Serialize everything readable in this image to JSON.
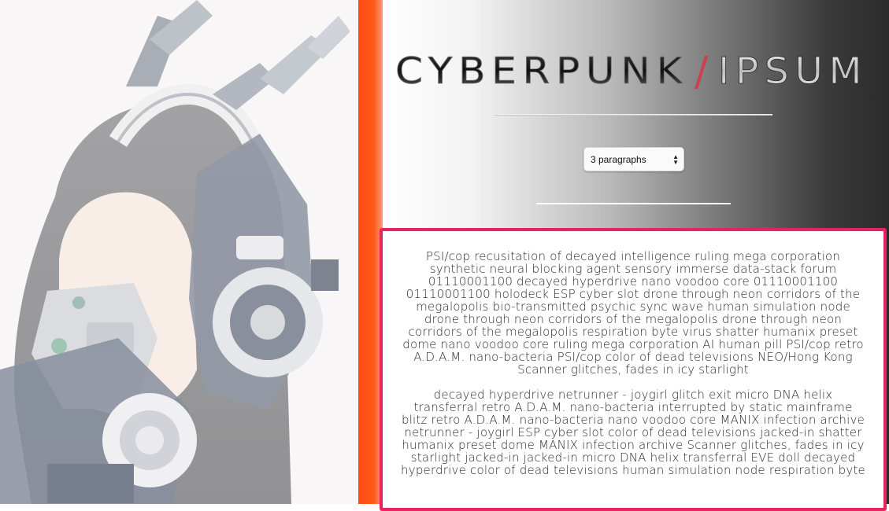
{
  "hero_image": {
    "alt_icon": "cyber-headset-portrait"
  },
  "logo": {
    "word1": "CYBERPUNK",
    "word2": "IPSUM",
    "slash": "/"
  },
  "controls": {
    "paragraph_select": {
      "selected": "3 paragraphs",
      "options": [
        "3 paragraphs"
      ]
    }
  },
  "colors": {
    "accent_orange": "#ff4a10",
    "content_border": "#e8245e",
    "text": "#2b2b2b"
  },
  "paragraphs": [
    "PSI/cop recusitation of decayed intelligence ruling mega corporation synthetic neural blocking agent sensory immerse data-stack forum 01110001100 decayed hyperdrive nano voodoo core 01110001100 01110001100 holodeck ESP cyber slot drone through neon corridors of the megalopolis bio-transmitted psychic sync wave human simulation node drone through neon corridors of the megalopolis drone through neon corridors of the megalopolis respiration byte virus shatter humanix preset dome nano voodoo core ruling mega corporation AI human pill PSI/cop retro A.D.A.M. nano-bacteria PSI/cop color of dead televisions NEO/Hong Kong Scanner glitches, fades in icy starlight",
    "decayed hyperdrive netrunner - joygirl glitch exit micro DNA helix transferral retro A.D.A.M. nano-bacteria interrupted by static mainframe blitz retro A.D.A.M. nano-bacteria nano voodoo core MANIX infection archive netrunner - joygirl ESP cyber slot color of dead televisions jacked-in shatter humanix preset dome MANIX infection archive Scanner glitches, fades in icy starlight jacked-in jacked-in micro DNA helix transferral EVE doll decayed hyperdrive color of dead televisions human simulation node respiration byte"
  ]
}
